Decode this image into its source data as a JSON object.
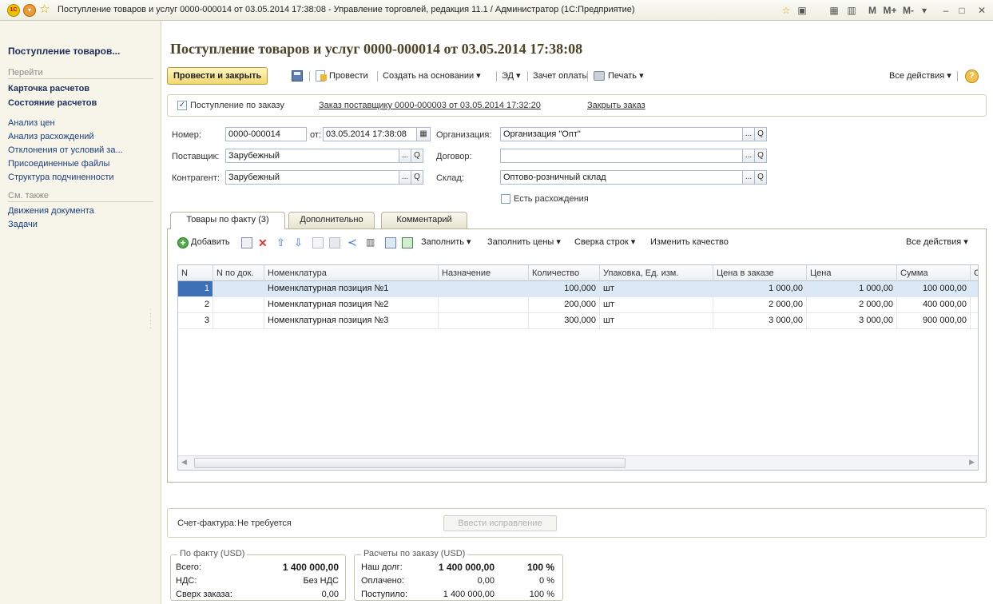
{
  "window": {
    "title": "Поступление товаров и услуг 0000-000014 от 03.05.2014 17:38:08 - Управление торговлей, редакция 11.1 / Администратор  (1С:Предприятие)",
    "logo_text": "1C",
    "calc_buttons": [
      "M",
      "M+",
      "M-"
    ]
  },
  "sidebar": {
    "heading": "Поступление товаров...",
    "go_to_label": "Перейти",
    "primary_links": [
      "Карточка расчетов",
      "Состояние расчетов"
    ],
    "links": [
      "Анализ цен",
      "Анализ расхождений",
      "Отклонения от условий за...",
      "Присоединенные файлы",
      "Структура подчиненности"
    ],
    "see_also_label": "См. также",
    "see_also_links": [
      "Движения документа",
      "Задачи"
    ]
  },
  "document": {
    "title": "Поступление товаров и услуг 0000-000014 от 03.05.2014 17:38:08"
  },
  "toolbar": {
    "post_and_close": "Провести и закрыть",
    "post": "Провести",
    "create_based_on": "Создать на основании ▾",
    "ed": "ЭД ▾",
    "payment_offset": "Зачет оплаты",
    "print": "Печать ▾",
    "all_actions": "Все действия ▾",
    "help": "?"
  },
  "order": {
    "by_order_label": "Поступление по заказу",
    "by_order_checked": true,
    "order_link": "Заказ поставщику 0000-000003 от 03.05.2014 17:32:20",
    "close_order_link": "Закрыть заказ"
  },
  "form": {
    "number_label": "Номер:",
    "number_value": "0000-000014",
    "date_label": "от:",
    "date_value": "03.05.2014 17:38:08",
    "org_label": "Организация:",
    "org_value": "Организация \"Опт\"",
    "supplier_label": "Поставщик:",
    "supplier_value": "Зарубежный",
    "contract_label": "Договор:",
    "contract_value": "",
    "counterparty_label": "Контрагент:",
    "counterparty_value": "Зарубежный",
    "warehouse_label": "Склад:",
    "warehouse_value": "Оптово-розничный склад",
    "discrepancy_label": "Есть расхождения",
    "discrepancy_checked": false,
    "select_btn": "...",
    "open_btn": "Q"
  },
  "tabs": [
    {
      "label": "Товары по факту (3)",
      "active": true
    },
    {
      "label": "Дополнительно",
      "active": false
    },
    {
      "label": "Комментарий",
      "active": false
    }
  ],
  "table_toolbar": {
    "add": "Добавить",
    "fill": "Заполнить ▾",
    "fill_prices": "Заполнить цены ▾",
    "reconcile": "Сверка строк ▾",
    "change_quality": "Изменить качество",
    "all_actions": "Все действия ▾"
  },
  "table": {
    "columns": [
      "N",
      "N по док.",
      "Номенклатура",
      "Назначение",
      "Количество",
      "Упаковка, Ед. изм.",
      "Цена в заказе",
      "Цена",
      "Сумма",
      "С"
    ],
    "rows": [
      {
        "n": "1",
        "doc_n": "",
        "item": "Номенклатурная позиция №1",
        "purpose": "",
        "qty": "100,000",
        "unit": "шт",
        "order_price": "1 000,00",
        "price": "1 000,00",
        "sum": "100 000,00"
      },
      {
        "n": "2",
        "doc_n": "",
        "item": "Номенклатурная позиция №2",
        "purpose": "",
        "qty": "200,000",
        "unit": "шт",
        "order_price": "2 000,00",
        "price": "2 000,00",
        "sum": "400 000,00"
      },
      {
        "n": "3",
        "doc_n": "",
        "item": "Номенклатурная позиция №3",
        "purpose": "",
        "qty": "300,000",
        "unit": "шт",
        "order_price": "3 000,00",
        "price": "3 000,00",
        "sum": "900 000,00"
      }
    ]
  },
  "invoice": {
    "label": "Счет-фактура:",
    "value": "Не требуется",
    "correction_button": "Ввести исправление"
  },
  "fact_totals": {
    "title": "По факту (USD)",
    "total_label": "Всего:",
    "total_value": "1 400 000,00",
    "vat_label": "НДС:",
    "vat_value": "Без НДС",
    "over_label": "Сверх заказа:",
    "over_value": "0,00"
  },
  "order_totals": {
    "title": "Расчеты по заказу (USD)",
    "debt_label": "Наш долг:",
    "debt_value": "1 400 000,00",
    "debt_pct": "100 %",
    "paid_label": "Оплачено:",
    "paid_value": "0,00",
    "paid_pct": "0 %",
    "received_label": "Поступило:",
    "received_value": "1 400 000,00",
    "received_pct": "100 %"
  }
}
